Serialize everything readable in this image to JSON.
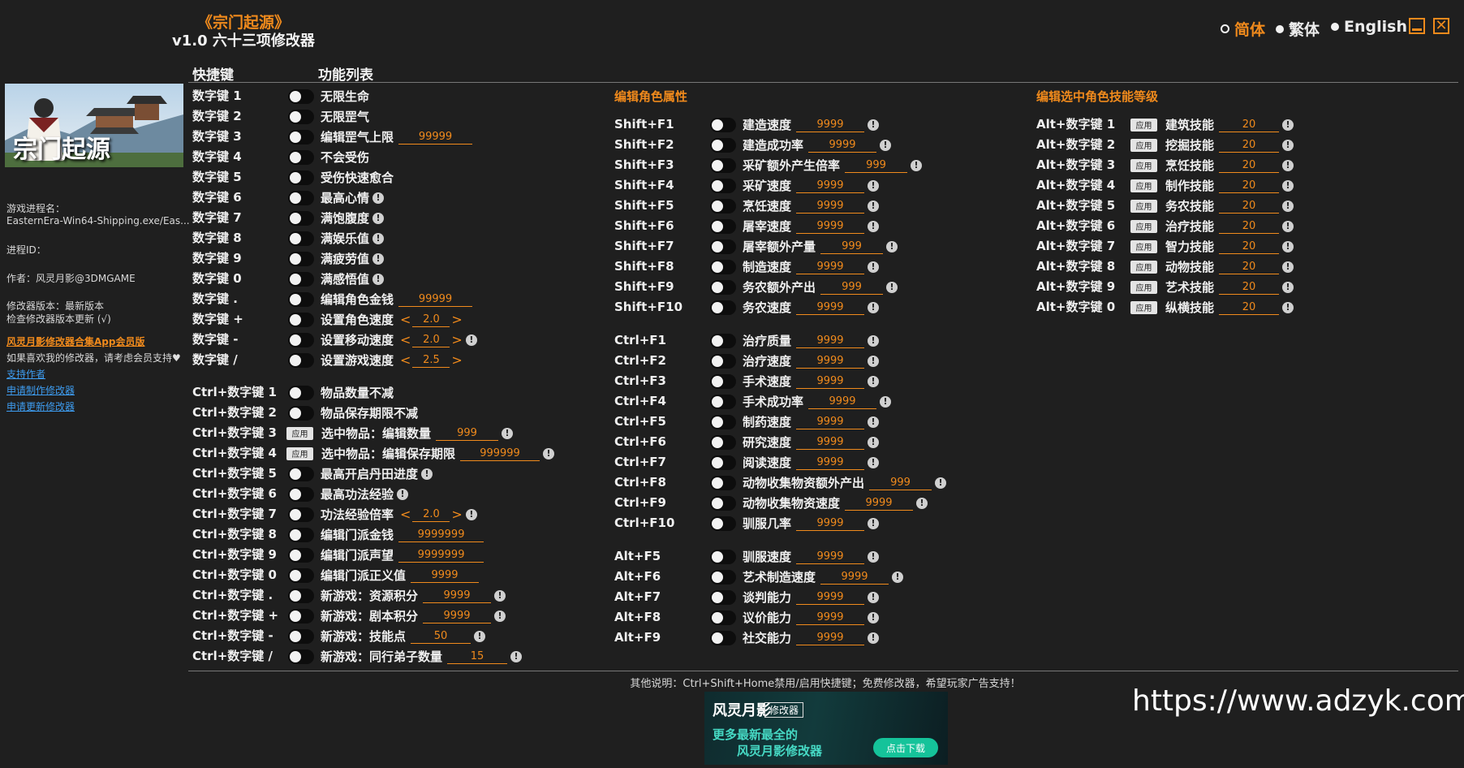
{
  "header": {
    "title": "《宗门起源》",
    "subtitle": "v1.0 六十三项修改器",
    "languages": [
      "简体",
      "繁体",
      "English"
    ],
    "active_language": "简体",
    "minimize_icon": "minimize-icon",
    "close_icon": "close-icon",
    "close_glyph": "✕"
  },
  "columns": {
    "hotkey_header": "快捷键",
    "function_header": "功能列表"
  },
  "sidebar": {
    "banner_text": "宗门起源",
    "process_label": "游戏进程名：",
    "process_value": "EasternEra-Win64-Shipping.exe/Eas...",
    "pid_label": "进程ID：",
    "author": "作者：风灵月影@3DMGAME",
    "version": "修改器版本：最新版本",
    "check_update": "检查修改器版本更新 (√)",
    "vip_link": "风灵月影修改器合集App会员版",
    "support_text": "如果喜欢我的修改器，请考虑会员支持",
    "support_author": "支持作者",
    "request_new": "申请制作修改器",
    "request_update": "申请更新修改器"
  },
  "sections": {
    "character": "编辑角色属性",
    "skills": "编辑选中角色技能等级"
  },
  "labels": {
    "apply": "应用",
    "info": "!",
    "arrow_left": "<",
    "arrow_right": ">"
  },
  "col1": [
    {
      "key": "数字键 1",
      "name": "无限生命",
      "type": "toggle"
    },
    {
      "key": "数字键 2",
      "name": "无限罡气",
      "type": "toggle"
    },
    {
      "key": "数字键 3",
      "name": "编辑罡气上限",
      "type": "toggle",
      "value": "99999"
    },
    {
      "key": "数字键 4",
      "name": "不会受伤",
      "type": "toggle"
    },
    {
      "key": "数字键 5",
      "name": "受伤快速愈合",
      "type": "toggle"
    },
    {
      "key": "数字键 6",
      "name": "最高心情",
      "type": "toggle",
      "info": true
    },
    {
      "key": "数字键 7",
      "name": "满饱腹度",
      "type": "toggle",
      "info": true
    },
    {
      "key": "数字键 8",
      "name": "满娱乐值",
      "type": "toggle",
      "info": true
    },
    {
      "key": "数字键 9",
      "name": "满疲劳值",
      "type": "toggle",
      "info": true
    },
    {
      "key": "数字键 0",
      "name": "满感悟值",
      "type": "toggle",
      "info": true
    },
    {
      "key": "数字键 .",
      "name": "编辑角色金钱",
      "type": "toggle",
      "value": "99999"
    },
    {
      "key": "数字键 +",
      "name": "设置角色速度",
      "type": "toggle",
      "spin": "2.0"
    },
    {
      "key": "数字键 -",
      "name": "设置移动速度",
      "type": "toggle",
      "spin": "2.0",
      "info": true
    },
    {
      "key": "数字键 /",
      "name": "设置游戏速度",
      "type": "toggle",
      "spin": "2.5"
    }
  ],
  "col1b": [
    {
      "key": "Ctrl+数字键 1",
      "name": "物品数量不减",
      "type": "toggle"
    },
    {
      "key": "Ctrl+数字键 2",
      "name": "物品保存期限不减",
      "type": "toggle"
    },
    {
      "key": "Ctrl+数字键 3",
      "name": "选中物品：编辑数量",
      "type": "apply",
      "value": "999",
      "info": true
    },
    {
      "key": "Ctrl+数字键 4",
      "name": "选中物品：编辑保存期限",
      "type": "apply",
      "value": "999999",
      "info": true
    },
    {
      "key": "Ctrl+数字键 5",
      "name": "最高开启丹田进度",
      "type": "toggle",
      "info": true
    },
    {
      "key": "Ctrl+数字键 6",
      "name": "最高功法经验",
      "type": "toggle",
      "info": true
    },
    {
      "key": "Ctrl+数字键 7",
      "name": "功法经验倍率",
      "type": "toggle",
      "spin": "2.0",
      "info": true
    },
    {
      "key": "Ctrl+数字键 8",
      "name": "编辑门派金钱",
      "type": "toggle",
      "value": "9999999"
    },
    {
      "key": "Ctrl+数字键 9",
      "name": "编辑门派声望",
      "type": "toggle",
      "value": "9999999"
    },
    {
      "key": "Ctrl+数字键 0",
      "name": "编辑门派正义值",
      "type": "toggle",
      "value": "9999"
    },
    {
      "key": "Ctrl+数字键 .",
      "name": "新游戏：资源积分",
      "type": "toggle",
      "value": "9999",
      "info": true
    },
    {
      "key": "Ctrl+数字键 +",
      "name": "新游戏：剧本积分",
      "type": "toggle",
      "value": "9999",
      "info": true
    },
    {
      "key": "Ctrl+数字键 -",
      "name": "新游戏：技能点",
      "type": "toggle",
      "value": "50",
      "info": true
    },
    {
      "key": "Ctrl+数字键 /",
      "name": "新游戏：同行弟子数量",
      "type": "toggle",
      "value": "15",
      "info": true
    }
  ],
  "col2": [
    {
      "key": "Shift+F1",
      "name": "建造速度",
      "type": "toggle",
      "value": "9999",
      "info": true
    },
    {
      "key": "Shift+F2",
      "name": "建造成功率",
      "type": "toggle",
      "value": "9999",
      "info": true
    },
    {
      "key": "Shift+F3",
      "name": "采矿额外产生倍率",
      "type": "toggle",
      "value": "999",
      "info": true
    },
    {
      "key": "Shift+F4",
      "name": "采矿速度",
      "type": "toggle",
      "value": "9999",
      "info": true
    },
    {
      "key": "Shift+F5",
      "name": "烹饪速度",
      "type": "toggle",
      "value": "9999",
      "info": true
    },
    {
      "key": "Shift+F6",
      "name": "屠宰速度",
      "type": "toggle",
      "value": "9999",
      "info": true
    },
    {
      "key": "Shift+F7",
      "name": "屠宰额外产量",
      "type": "toggle",
      "value": "999",
      "info": true
    },
    {
      "key": "Shift+F8",
      "name": "制造速度",
      "type": "toggle",
      "value": "9999",
      "info": true
    },
    {
      "key": "Shift+F9",
      "name": "务农额外产出",
      "type": "toggle",
      "value": "999",
      "info": true
    },
    {
      "key": "Shift+F10",
      "name": "务农速度",
      "type": "toggle",
      "value": "9999",
      "info": true
    }
  ],
  "col2b": [
    {
      "key": "Ctrl+F1",
      "name": "治疗质量",
      "type": "toggle",
      "value": "9999",
      "info": true
    },
    {
      "key": "Ctrl+F2",
      "name": "治疗速度",
      "type": "toggle",
      "value": "9999",
      "info": true
    },
    {
      "key": "Ctrl+F3",
      "name": "手术速度",
      "type": "toggle",
      "value": "9999",
      "info": true
    },
    {
      "key": "Ctrl+F4",
      "name": "手术成功率",
      "type": "toggle",
      "value": "9999",
      "info": true
    },
    {
      "key": "Ctrl+F5",
      "name": "制药速度",
      "type": "toggle",
      "value": "9999",
      "info": true
    },
    {
      "key": "Ctrl+F6",
      "name": "研究速度",
      "type": "toggle",
      "value": "9999",
      "info": true
    },
    {
      "key": "Ctrl+F7",
      "name": "阅读速度",
      "type": "toggle",
      "value": "9999",
      "info": true
    },
    {
      "key": "Ctrl+F8",
      "name": "动物收集物资额外产出",
      "type": "toggle",
      "value": "999",
      "info": true
    },
    {
      "key": "Ctrl+F9",
      "name": "动物收集物资速度",
      "type": "toggle",
      "value": "9999",
      "info": true
    },
    {
      "key": "Ctrl+F10",
      "name": "驯服几率",
      "type": "toggle",
      "value": "9999",
      "info": true
    }
  ],
  "col2c": [
    {
      "key": "Alt+F5",
      "name": "驯服速度",
      "type": "toggle",
      "value": "9999",
      "info": true
    },
    {
      "key": "Alt+F6",
      "name": "艺术制造速度",
      "type": "toggle",
      "value": "9999",
      "info": true
    },
    {
      "key": "Alt+F7",
      "name": "谈判能力",
      "type": "toggle",
      "value": "9999",
      "info": true
    },
    {
      "key": "Alt+F8",
      "name": "议价能力",
      "type": "toggle",
      "value": "9999",
      "info": true
    },
    {
      "key": "Alt+F9",
      "name": "社交能力",
      "type": "toggle",
      "value": "9999",
      "info": true
    }
  ],
  "col3": [
    {
      "key": "Alt+数字键 1",
      "name": "建筑技能",
      "type": "apply",
      "value": "20",
      "info": true
    },
    {
      "key": "Alt+数字键 2",
      "name": "挖掘技能",
      "type": "apply",
      "value": "20",
      "info": true
    },
    {
      "key": "Alt+数字键 3",
      "name": "烹饪技能",
      "type": "apply",
      "value": "20",
      "info": true
    },
    {
      "key": "Alt+数字键 4",
      "name": "制作技能",
      "type": "apply",
      "value": "20",
      "info": true
    },
    {
      "key": "Alt+数字键 5",
      "name": "务农技能",
      "type": "apply",
      "value": "20",
      "info": true
    },
    {
      "key": "Alt+数字键 6",
      "name": "治疗技能",
      "type": "apply",
      "value": "20",
      "info": true
    },
    {
      "key": "Alt+数字键 7",
      "name": "智力技能",
      "type": "apply",
      "value": "20",
      "info": true
    },
    {
      "key": "Alt+数字键 8",
      "name": "动物技能",
      "type": "apply",
      "value": "20",
      "info": true
    },
    {
      "key": "Alt+数字键 9",
      "name": "艺术技能",
      "type": "apply",
      "value": "20",
      "info": true
    },
    {
      "key": "Alt+数字键 0",
      "name": "纵横技能",
      "type": "apply",
      "value": "20",
      "info": true
    }
  ],
  "footer": {
    "note": "其他说明：Ctrl+Shift+Home禁用/启用快捷键；免费修改器，希望玩家广告支持！",
    "ad_logo": "风灵月影",
    "ad_tag": "修改器",
    "ad_line1": "更多最新最全的",
    "ad_line2": "风灵月影修改器",
    "ad_download": "点击下载",
    "watermark": "https://www.adzyk.com/"
  },
  "colors": {
    "accent": "#f08a1c",
    "background": "#1f1f1f",
    "link": "#3d9cf0"
  }
}
